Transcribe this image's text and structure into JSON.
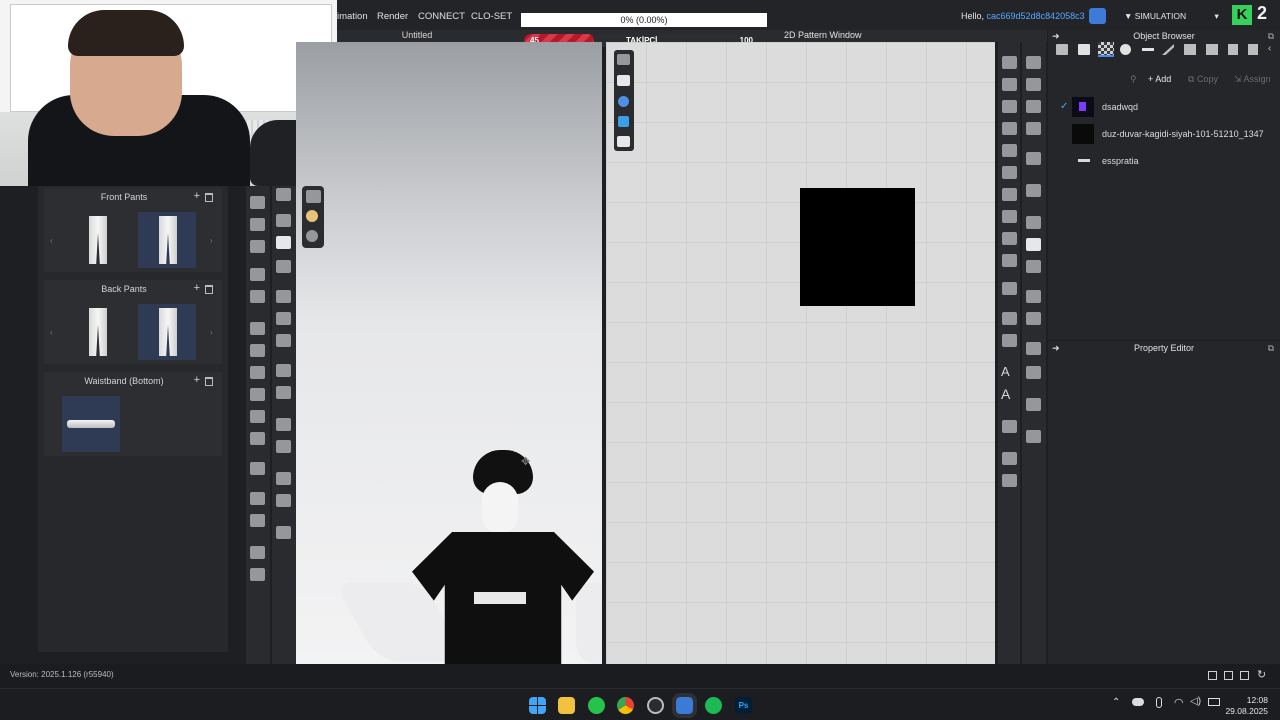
{
  "menu": {
    "items": [
      "imation",
      "Render",
      "CONNECT",
      "CLO-SET"
    ],
    "hello_prefix": "Hello,",
    "user_id": "cac669d52d8c842058c3",
    "mode": "SIMULATION"
  },
  "progress_box": {
    "text": "0% (0.00%)",
    "percent": 0
  },
  "follower_bar": {
    "label": "TAKİPÇİ",
    "min": "45",
    "max": "100",
    "fill_fraction": 0.3
  },
  "viewport3d": {
    "title": "Untitled"
  },
  "window2d": {
    "title": "2D Pattern Window"
  },
  "left_panel": {
    "sections": [
      {
        "title": "Front Pants",
        "thumbs": 2
      },
      {
        "title": "Back Pants",
        "thumbs": 2
      },
      {
        "title": "Waistband (Bottom)",
        "thumbs": 1
      }
    ]
  },
  "object_browser": {
    "title": "Object Browser",
    "actions": {
      "add": "Add",
      "copy": "Copy",
      "assign": "Assign"
    },
    "items": [
      {
        "name": "dsadwqd",
        "checked": true
      },
      {
        "name": "duz-duvar-kagidi-siyah-101-51210_1347",
        "checked": false
      },
      {
        "name": "esspratia",
        "checked": false
      }
    ]
  },
  "property_editor": {
    "title": "Property Editor"
  },
  "status": {
    "version": "Version: 2025.1.126 (r55940)"
  },
  "taskbar": {
    "time": "12:08",
    "date": "29.08.2025"
  },
  "brand": {
    "logo_letter": "K",
    "logo_number": "2"
  },
  "colors": {
    "accent_blue": "#59a8ff",
    "follower_red": "#c8283c",
    "logo_green": "#36d15a"
  }
}
